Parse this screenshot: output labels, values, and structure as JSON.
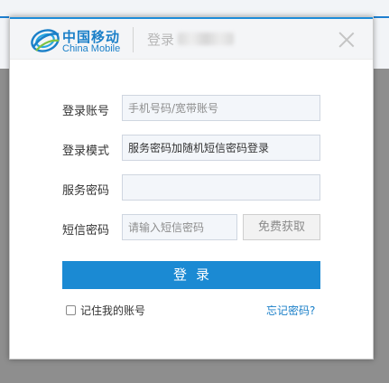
{
  "header": {
    "brand_cn": "中国移动",
    "brand_en": "China Mobile",
    "title": "登录"
  },
  "form": {
    "account_label": "登录账号",
    "account_placeholder": "手机号码/宽带账号",
    "mode_label": "登录模式",
    "mode_value": "服务密码加随机短信密码登录",
    "password_label": "服务密码",
    "password_value": "",
    "sms_label": "短信密码",
    "sms_placeholder": "请输入短信密码",
    "sms_button": "免费获取",
    "login_button": "登录",
    "remember_label": "记住我的账号",
    "forgot_link": "忘记密码?"
  },
  "colors": {
    "brand_blue": "#1a7fc8",
    "login_button": "#1b8ad3",
    "overlay": "#8e8e8e"
  }
}
